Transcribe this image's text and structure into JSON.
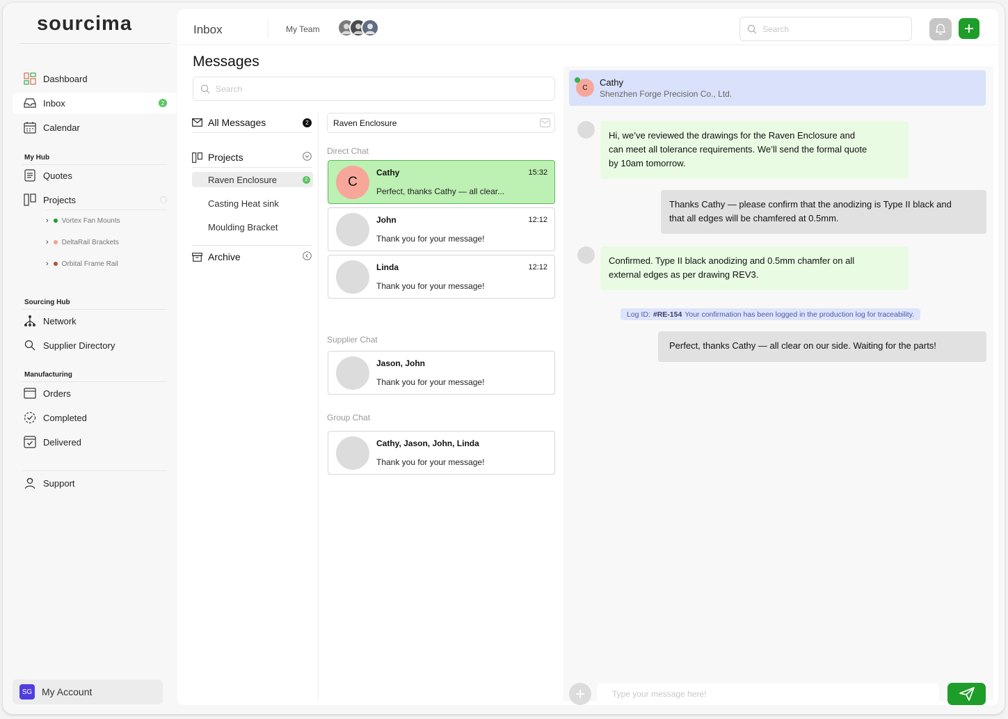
{
  "brand": "sourcima",
  "sidebar": {
    "items": [
      {
        "label": "Dashboard",
        "icon": "dashboard-icon"
      },
      {
        "label": "Inbox",
        "icon": "inbox-icon",
        "badge": "2"
      },
      {
        "label": "Calendar",
        "icon": "calendar-icon"
      }
    ],
    "my_hub": {
      "label": "My Hub",
      "items": [
        {
          "label": "Quotes",
          "icon": "quotes-icon"
        },
        {
          "label": "Projects",
          "icon": "projects-icon"
        }
      ],
      "projects": [
        {
          "label": "Vortex Fan Mounts",
          "color": "#1f9d2a"
        },
        {
          "label": "DeltaRail Brackets",
          "color": "#f2a08c"
        },
        {
          "label": "Orbital Frame Rail",
          "color": "#b5512f"
        }
      ]
    },
    "sourcing_hub": {
      "label": "Sourcing Hub",
      "items": [
        {
          "label": "Network",
          "icon": "network-icon"
        },
        {
          "label": "Supplier Directory",
          "icon": "search-icon"
        }
      ]
    },
    "manufacturing": {
      "label": "Manufacturing",
      "items": [
        {
          "label": "Orders",
          "icon": "orders-icon"
        },
        {
          "label": "Completed",
          "icon": "completed-icon"
        },
        {
          "label": "Delivered",
          "icon": "delivered-icon"
        }
      ]
    },
    "support": {
      "label": "Support",
      "icon": "support-icon"
    },
    "account": {
      "initials": "SG",
      "label": "My Account"
    }
  },
  "topbar": {
    "title": "Inbox",
    "team_label": "My Team",
    "search_placeholder": "Search"
  },
  "messages": {
    "title": "Messages",
    "search_placeholder": "Search",
    "folders": {
      "all": {
        "label": "All Messages",
        "badge": "2"
      },
      "projects": {
        "label": "Projects"
      },
      "archive": {
        "label": "Archive"
      }
    },
    "projects": [
      {
        "label": "Raven Enclosure",
        "badge": "2"
      },
      {
        "label": "Casting Heat sink"
      },
      {
        "label": "Moulding Bracket"
      }
    ],
    "selected_project": "Raven Enclosure",
    "groups": {
      "direct": "Direct Chat",
      "supplier": "Supplier Chat",
      "group": "Group Chat"
    },
    "direct": [
      {
        "initial": "C",
        "name": "Cathy",
        "time": "15:32",
        "preview": "Perfect, thanks Cathy — all clear..."
      },
      {
        "name": "John",
        "time": "12:12",
        "preview": "Thank you for your message!"
      },
      {
        "name": "Linda",
        "time": "12:12",
        "preview": "Thank you for your message!"
      }
    ],
    "supplier": [
      {
        "name": "Jason, John",
        "preview": "Thank you for your message!"
      }
    ],
    "group": [
      {
        "name": "Cathy, Jason, John, Linda",
        "preview": "Thank you for your message!"
      }
    ]
  },
  "chat": {
    "contact": {
      "initial": "C",
      "name": "Cathy",
      "company": "Shenzhen Forge Precision Co., Ltd."
    },
    "messages": [
      {
        "dir": "in",
        "lines": [
          "Hi, we’ve reviewed the drawings for the Raven Enclosure and",
          "can meet all tolerance requirements. We’ll send the formal quote",
          "by 10am tomorrow."
        ]
      },
      {
        "dir": "out",
        "lines": [
          "Thanks Cathy — please confirm that the anodizing is Type II black and",
          "that all edges will be chamfered at 0.5mm."
        ]
      },
      {
        "dir": "in",
        "lines": [
          "Confirmed. Type II black anodizing and 0.5mm chamfer on all",
          "external edges as per drawing REV3."
        ]
      },
      {
        "dir": "out",
        "lines": [
          "Perfect, thanks Cathy — all clear on our side. Waiting for the parts!"
        ]
      }
    ],
    "log": {
      "prefix": "Log ID:",
      "id": "#RE-154",
      "text": "Your confirmation has been logged in the production log for traceability."
    },
    "composer_placeholder": "Type your message here!"
  }
}
